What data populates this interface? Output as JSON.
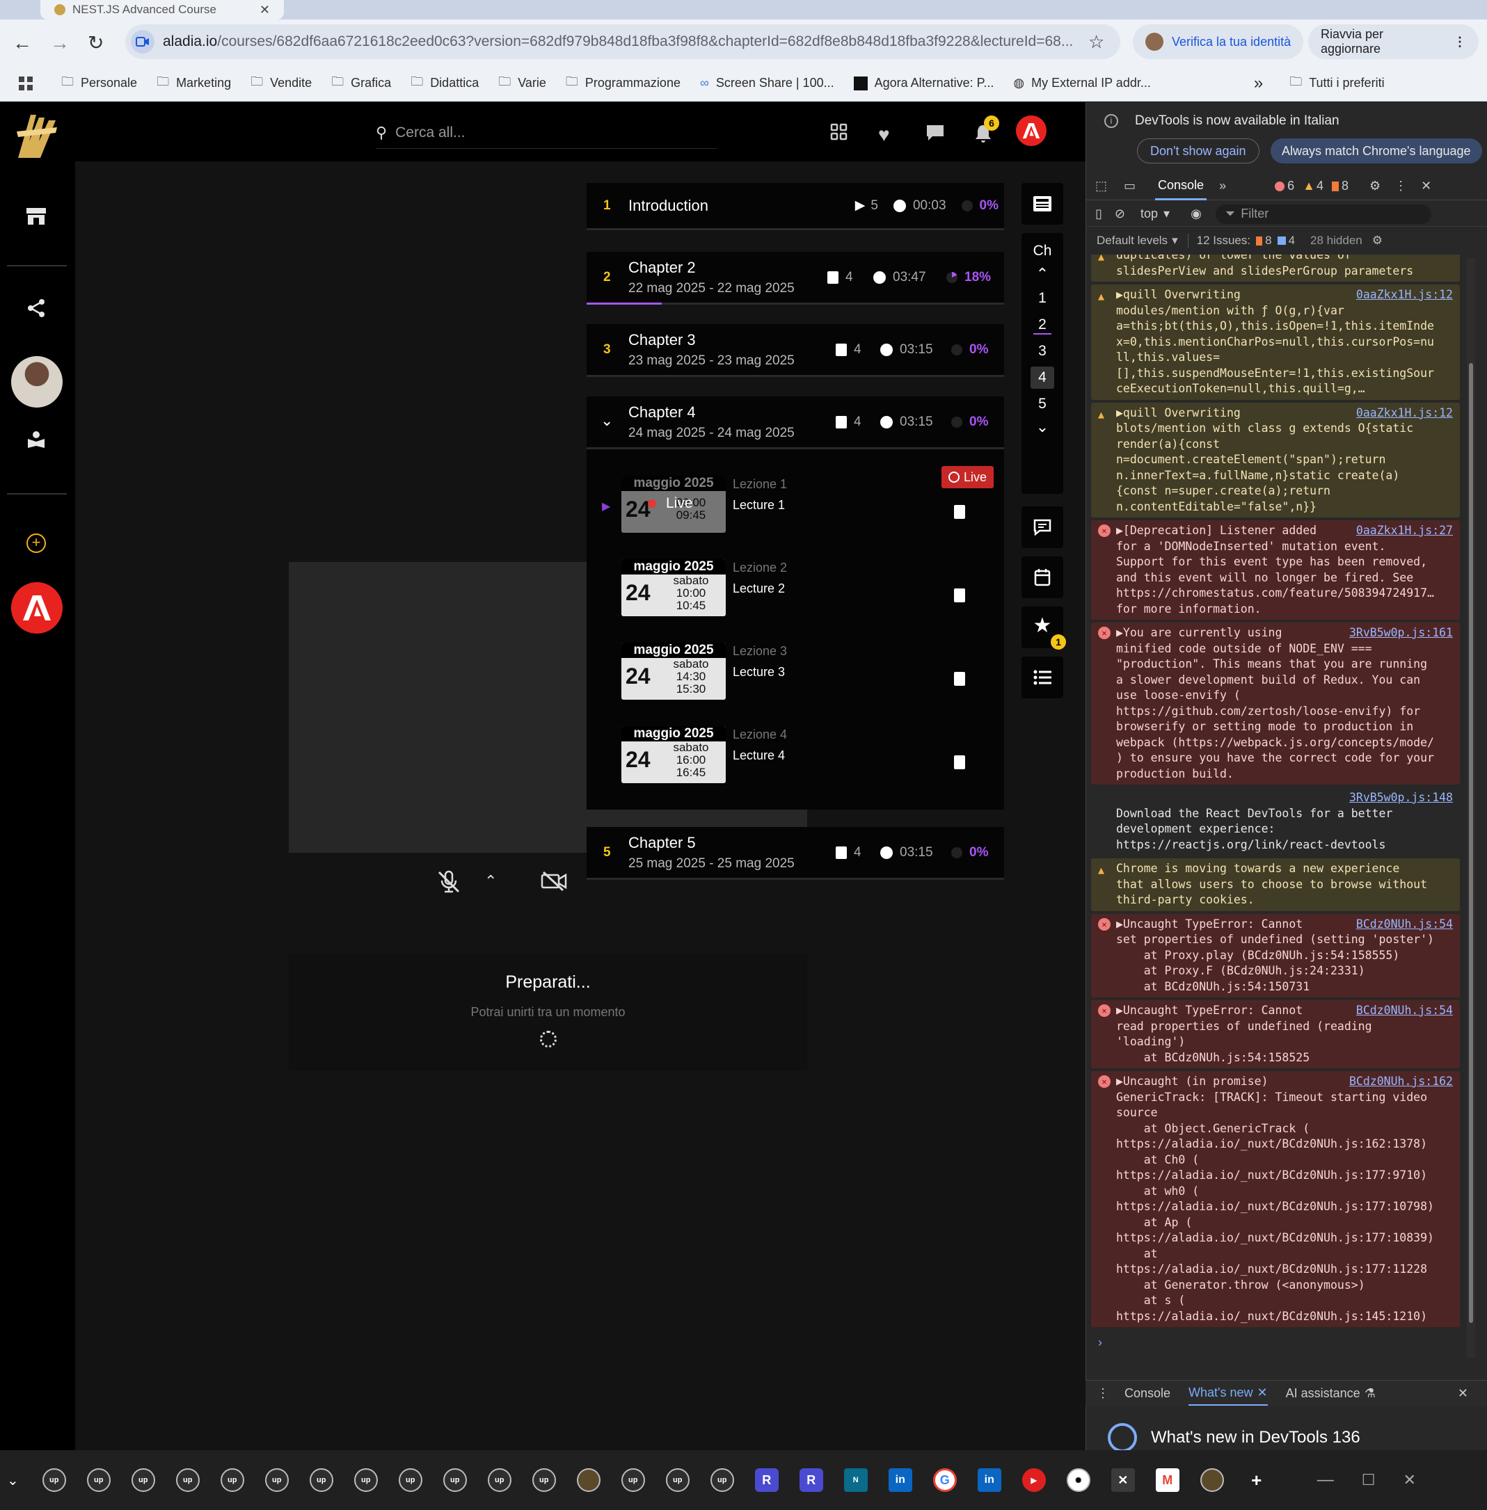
{
  "browser": {
    "tab_title": "NEST.JS Advanced Course",
    "url_host": "aladia.io",
    "url_path": "/courses/682df6aa6721618c2eed0c63?version=682df979b848d18fba3f98f8&chapterId=682df8e8b848d18fba3f9228&lectureId=68...",
    "verify_label": "Verifica la tua identità",
    "restart_label": "Riavvia per aggiornare",
    "bookmarks": [
      "Personale",
      "Marketing",
      "Vendite",
      "Grafica",
      "Didattica",
      "Varie",
      "Programmazione",
      "Screen Share | 100...",
      "Agora Alternative: P...",
      "My External IP addr..."
    ],
    "bookmarks_more": "»",
    "all_bookmarks": "Tutti i preferiti"
  },
  "app": {
    "search_placeholder": "Cerca all...",
    "notification_count": "6",
    "favorites_count": "1",
    "rail_label": "Ch",
    "rail_numbers": [
      "1",
      "2",
      "3",
      "4",
      "5"
    ],
    "preparing_title": "Preparati...",
    "preparing_sub": "Potrai unirti tra un momento",
    "live_badge": "Live",
    "chapters": [
      {
        "num": "1",
        "title": "Introduction",
        "date": "",
        "count": "5",
        "duration": "00:03",
        "progress": "0%"
      },
      {
        "num": "2",
        "title": "Chapter 2",
        "date": "22 mag 2025 - 22 mag 2025",
        "count": "4",
        "duration": "03:47",
        "progress": "18%"
      },
      {
        "num": "3",
        "title": "Chapter 3",
        "date": "23 mag 2025 - 23 mag 2025",
        "count": "4",
        "duration": "03:15",
        "progress": "0%"
      },
      {
        "num": "",
        "title": "Chapter 4",
        "date": "24 mag 2025 - 24 mag 2025",
        "count": "4",
        "duration": "03:15",
        "progress": "0%"
      },
      {
        "num": "5",
        "title": "Chapter 5",
        "date": "25 mag 2025 - 25 mag 2025",
        "count": "4",
        "duration": "03:15",
        "progress": "0%"
      }
    ],
    "lectures": [
      {
        "month": "maggio 2025",
        "day": "24",
        "weekday": "",
        "start": "09:00",
        "end": "09:45",
        "label": "Lezione 1",
        "title": "Lecture 1",
        "live": "Live"
      },
      {
        "month": "maggio 2025",
        "day": "24",
        "weekday": "sabato",
        "start": "10:00",
        "end": "10:45",
        "label": "Lezione 2",
        "title": "Lecture 2"
      },
      {
        "month": "maggio 2025",
        "day": "24",
        "weekday": "sabato",
        "start": "14:30",
        "end": "15:30",
        "label": "Lezione 3",
        "title": "Lecture 3"
      },
      {
        "month": "maggio 2025",
        "day": "24",
        "weekday": "sabato",
        "start": "16:00",
        "end": "16:45",
        "label": "Lezione 4",
        "title": "Lecture 4"
      }
    ]
  },
  "devtools": {
    "banner": "DevTools is now available in Italian",
    "dont_show": "Don't show again",
    "always_match": "Always match Chrome's language",
    "tab_console": "Console",
    "errors": "6",
    "warnings": "4",
    "issues_badge": "8",
    "context": "top",
    "filter": "Filter",
    "levels": "Default levels",
    "issues_label": "12 Issues:",
    "issues_a": "8",
    "issues_b": "4",
    "hidden": "28 hidden",
    "messages": [
      {
        "type": "warn",
        "text": "duplicates) or lower the values of\nslidesPerView and slidesPerGroup parameters",
        "link": ""
      },
      {
        "type": "warn",
        "text": "▶quill Overwriting\nmodules/mention with ƒ O(g,r){var\na=this;bt(this,O),this.isOpen=!1,this.itemInde\nx=0,this.mentionCharPos=null,this.cursorPos=nu\nll,this.values=\n[],this.suspendMouseEnter=!1,this.existingSour\nceExecutionToken=null,this.quill=g,…",
        "link": "0aaZkx1H.js:12"
      },
      {
        "type": "warn",
        "text": "▶quill Overwriting\nblots/mention with class g extends O{static\nrender(a){const\nn=document.createElement(\"span\");return\nn.innerText=a.fullName,n}static create(a)\n{const n=super.create(a);return\nn.contentEditable=\"false\",n}}",
        "link": "0aaZkx1H.js:12"
      },
      {
        "type": "err",
        "text": "▶[Deprecation] Listener added\nfor a 'DOMNodeInserted' mutation event.\nSupport for this event type has been removed,\nand this event will no longer be fired. See\nhttps://chromestatus.com/feature/508394724917…\nfor more information.",
        "link": "0aaZkx1H.js:27"
      },
      {
        "type": "err",
        "text": "▶You are currently using\nminified code outside of NODE_ENV ===\n\"production\". This means that you are running\na slower development build of Redux. You can\nuse loose-envify (\nhttps://github.com/zertosh/loose-envify) for\nbrowserify or setting mode to production in\nwebpack (https://webpack.js.org/concepts/mode/\n) to ensure you have the correct code for your\nproduction build.",
        "link": "3RvB5w0p.js:161"
      },
      {
        "type": "plain",
        "text": "\nDownload the React DevTools for a better\ndevelopment experience:\nhttps://reactjs.org/link/react-devtools",
        "link": "3RvB5w0p.js:148"
      },
      {
        "type": "warn",
        "text": "Chrome is moving towards a new experience\nthat allows users to choose to browse without\nthird-party cookies.",
        "link": ""
      },
      {
        "type": "err",
        "text": "▶Uncaught TypeError: Cannot\nset properties of undefined (setting 'poster')\n    at Proxy.play (BCdz0NUh.js:54:158555)\n    at Proxy.F (BCdz0NUh.js:24:2331)\n    at BCdz0NUh.js:54:150731",
        "link": "BCdz0NUh.js:54"
      },
      {
        "type": "err",
        "text": "▶Uncaught TypeError: Cannot\nread properties of undefined (reading\n'loading')\n    at BCdz0NUh.js:54:158525",
        "link": "BCdz0NUh.js:54"
      },
      {
        "type": "err",
        "text": "▶Uncaught (in promise)\nGenericTrack: [TRACK]: Timeout starting video\nsource\n    at Object.GenericTrack (\nhttps://aladia.io/_nuxt/BCdz0NUh.js:162:1378)\n    at Ch0 (\nhttps://aladia.io/_nuxt/BCdz0NUh.js:177:9710)\n    at wh0 (\nhttps://aladia.io/_nuxt/BCdz0NUh.js:177:10798)\n    at Ap (\nhttps://aladia.io/_nuxt/BCdz0NUh.js:177:10839)\n    at\nhttps://aladia.io/_nuxt/BCdz0NUh.js:177:11228\n    at Generator.throw (<anonymous>)\n    at s (\nhttps://aladia.io/_nuxt/BCdz0NUh.js:145:1210)",
        "link": "BCdz0NUh.js:162"
      }
    ],
    "drawer_console": "Console",
    "drawer_whatsnew": "What's new",
    "drawer_ai": "AI assistance",
    "whatsnew_title": "What's new in DevTools 136"
  },
  "colors": {
    "accent": "#a855f7",
    "chapter_num": "#f5c518",
    "live_red": "#d32f2f",
    "brand_red": "#e8231f"
  }
}
